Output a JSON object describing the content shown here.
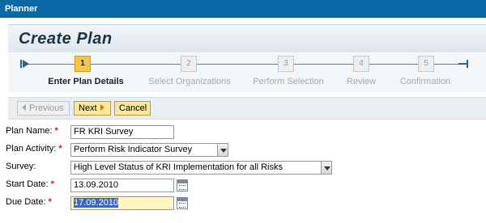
{
  "window": {
    "title": "Planner"
  },
  "header": {
    "title": "Create Plan"
  },
  "roadmap": {
    "steps": [
      {
        "number": "1",
        "label": "Enter Plan Details",
        "active": true
      },
      {
        "number": "2",
        "label": "Select Organizations",
        "active": false
      },
      {
        "number": "3",
        "label": "Perform Selection",
        "active": false
      },
      {
        "number": "4",
        "label": "Review",
        "active": false
      },
      {
        "number": "5",
        "label": "Confirmation",
        "active": false
      }
    ]
  },
  "toolbar": {
    "previous_label": "Previous",
    "next_label": "Next",
    "cancel_label": "Cancel"
  },
  "form": {
    "plan_name": {
      "label": "Plan Name:",
      "required": "*",
      "value": "FR KRI Survey"
    },
    "plan_activity": {
      "label": "Plan Activity:",
      "required": "*",
      "value": "Perform Risk Indicator Survey"
    },
    "survey": {
      "label": "Survey:",
      "value": "High Level Status of KRI Implementation for all Risks"
    },
    "start_date": {
      "label": "Start Date:",
      "required": "*",
      "value": "13.09.2010"
    },
    "due_date": {
      "label": "Due Date:",
      "required": "*",
      "value": "17.09.2010"
    }
  },
  "colors": {
    "titlebar": "#0a6aa8",
    "active_step": "#f4c64a",
    "button_yellow": "#fbe79e",
    "required": "#dd1111"
  }
}
